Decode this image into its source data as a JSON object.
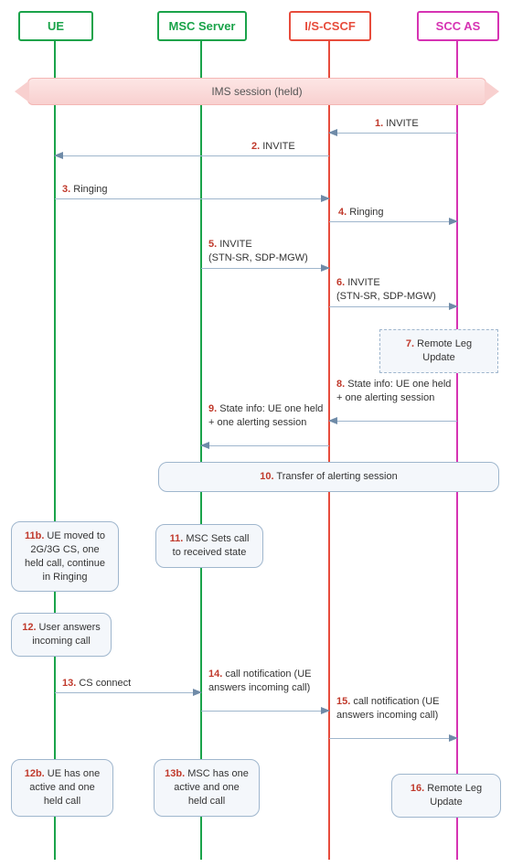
{
  "actors": {
    "ue": "UE",
    "msc": "MSC Server",
    "cscf": "I/S-CSCF",
    "scc": "SCC AS"
  },
  "colors": {
    "ue": "#1aa34a",
    "msc": "#1aa34a",
    "cscf": "#e74c3c",
    "scc": "#d633b3"
  },
  "session": "IMS session (held)",
  "msgs": {
    "m1": {
      "n": "1.",
      "t": " INVITE"
    },
    "m2": {
      "n": "2.",
      "t": " INVITE"
    },
    "m3": {
      "n": "3.",
      "t": " Ringing"
    },
    "m4": {
      "n": "4.",
      "t": " Ringing"
    },
    "m5": {
      "n": "5.",
      "t": " INVITE",
      "t2": "(STN-SR, SDP-MGW)"
    },
    "m6": {
      "n": "6.",
      "t": " INVITE",
      "t2": "(STN-SR, SDP-MGW)"
    },
    "m8": {
      "n": "8.",
      "t": " State info: UE one held + one alerting session"
    },
    "m9": {
      "n": "9.",
      "t": " State info: UE one held + one alerting session"
    },
    "m13": {
      "n": "13.",
      "t": " CS connect"
    },
    "m14": {
      "n": "14.",
      "t": " call notification (UE answers incoming call)"
    },
    "m15": {
      "n": "15.",
      "t": " call notification (UE answers incoming call)"
    }
  },
  "boxes": {
    "b7": {
      "n": "7.",
      "t": " Remote Leg Update"
    },
    "b10": {
      "n": "10.",
      "t": " Transfer of alerting session"
    },
    "b11": {
      "n": "11.",
      "t": " MSC Sets call to received state"
    },
    "b11b": {
      "n": "11b.",
      "t": " UE moved to 2G/3G CS, one held call, continue in Ringing"
    },
    "b12": {
      "n": "12.",
      "t": " User answers incoming call"
    },
    "b12b": {
      "n": "12b.",
      "t": " UE has one active and one held call"
    },
    "b13b": {
      "n": "13b.",
      "t": " MSC has one active and one held call"
    },
    "b16": {
      "n": "16.",
      "t": " Remote Leg Update"
    }
  }
}
